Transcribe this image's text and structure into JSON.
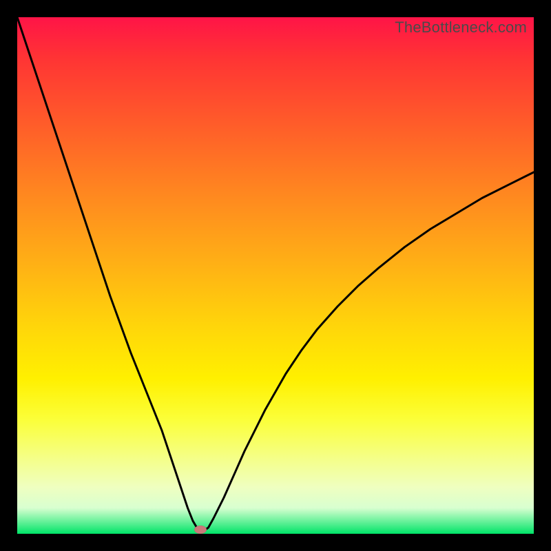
{
  "watermark": "TheBottleneck.com",
  "colors": {
    "frame": "#000000",
    "curve_stroke": "#000000",
    "marker_fill": "#c97a7a",
    "gradient_top": "#ff1447",
    "gradient_bottom": "#00e468"
  },
  "chart_data": {
    "type": "line",
    "title": "",
    "xlabel": "",
    "ylabel": "",
    "xlim": [
      0,
      100
    ],
    "ylim": [
      0,
      100
    ],
    "grid": false,
    "axes_visible": false,
    "background": "rainbow-gradient-red-to-green-vertical",
    "x": [
      0,
      1,
      2,
      3,
      4,
      5,
      6,
      8,
      10,
      12,
      14,
      16,
      18,
      20,
      22,
      24,
      26,
      28,
      30,
      31,
      32,
      33,
      34,
      35,
      36,
      37,
      38,
      40,
      42,
      44,
      46,
      48,
      50,
      52,
      55,
      58,
      62,
      66,
      70,
      75,
      80,
      85,
      90,
      95,
      100
    ],
    "y": [
      100,
      97,
      94,
      91,
      88,
      85,
      82,
      76,
      70,
      64,
      58,
      52,
      46,
      40.5,
      35,
      30,
      25,
      20,
      14,
      11,
      8,
      5,
      2.5,
      0.8,
      0.5,
      1.2,
      3,
      7,
      11.5,
      16,
      20,
      24,
      27.5,
      31,
      35.5,
      39.5,
      44,
      48,
      51.5,
      55.5,
      59,
      62,
      65,
      67.5,
      70
    ],
    "marker": {
      "x": 35.5,
      "y": 0.8
    },
    "annotations": []
  }
}
